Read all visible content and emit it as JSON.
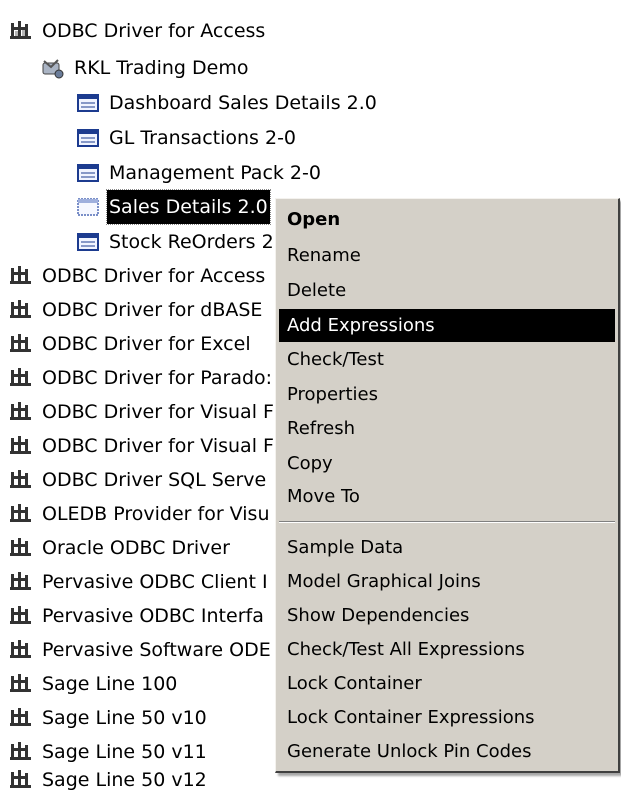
{
  "tree": {
    "root": {
      "label": "ODBC Driver for Access",
      "icon": "odbc-driver-icon"
    },
    "datasource": {
      "label": "RKL Trading Demo",
      "icon": "satellite-datasource-icon"
    },
    "containers": [
      {
        "label": "Dashboard Sales Details 2.0",
        "icon": "container-icon"
      },
      {
        "label": "GL Transactions 2-0",
        "icon": "container-icon"
      },
      {
        "label": "Management Pack 2-0",
        "icon": "container-icon"
      },
      {
        "label": "Sales Details 2.0",
        "icon": "container-icon",
        "selected": true
      },
      {
        "label": "Stock ReOrders 2",
        "icon": "container-icon"
      }
    ],
    "drivers": [
      {
        "label": "ODBC Driver for Access"
      },
      {
        "label": "ODBC Driver for dBASE"
      },
      {
        "label": "ODBC Driver for Excel"
      },
      {
        "label": "ODBC Driver for Parado:"
      },
      {
        "label": "ODBC Driver for Visual F"
      },
      {
        "label": "ODBC Driver for Visual F"
      },
      {
        "label": "ODBC Driver SQL Serve"
      },
      {
        "label": "OLEDB Provider for Visu"
      },
      {
        "label": "Oracle ODBC Driver"
      },
      {
        "label": "Pervasive ODBC Client I"
      },
      {
        "label": "Pervasive ODBC Interfa"
      },
      {
        "label": "Pervasive Software ODE"
      },
      {
        "label": "Sage Line 100"
      },
      {
        "label": "Sage Line 50 v10"
      },
      {
        "label": "Sage Line 50 v11"
      },
      {
        "label": "Sage Line 50 v12"
      }
    ]
  },
  "context_menu": {
    "group1": [
      {
        "label": "Open",
        "bold": true
      },
      {
        "label": "Rename"
      },
      {
        "label": "Delete"
      },
      {
        "label": "Add Expressions",
        "highlighted": true
      },
      {
        "label": "Check/Test"
      },
      {
        "label": "Properties"
      },
      {
        "label": "Refresh"
      },
      {
        "label": "Copy"
      },
      {
        "label": "Move To"
      }
    ],
    "group2": [
      {
        "label": "Sample Data"
      },
      {
        "label": "Model Graphical Joins"
      },
      {
        "label": "Show Dependencies"
      },
      {
        "label": "Check/Test All Expressions"
      },
      {
        "label": "Lock Container"
      },
      {
        "label": "Lock Container Expressions"
      },
      {
        "label": "Generate Unlock Pin Codes"
      }
    ]
  },
  "colors": {
    "menu_bg": "#d4d0c8",
    "highlight": "#000000",
    "tree_bg": "#ffffff"
  }
}
